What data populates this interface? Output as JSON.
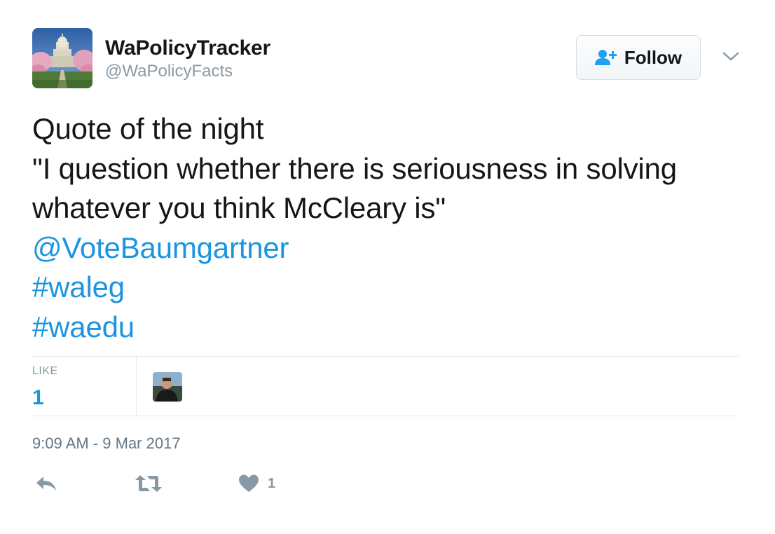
{
  "user": {
    "name": "WaPolicyTracker",
    "handle": "@WaPolicyFacts",
    "avatar_icon": "capitol-building-photo"
  },
  "follow_button": {
    "label": "Follow",
    "icon": "add-person-icon"
  },
  "menu_icon": "chevron-down-icon",
  "tweet": {
    "lines": [
      "Quote of the night",
      "\"I question whether there is seriousness in solving",
      "whatever you think McCleary is\""
    ],
    "mention": "@VoteBaumgartner",
    "hashtags": [
      "#waleg",
      "#waedu"
    ]
  },
  "stats": {
    "like_label": "LIKE",
    "like_count": "1"
  },
  "timestamp": "9:09 AM - 9 Mar 2017",
  "actions": {
    "reply_icon": "reply-icon",
    "retweet_icon": "retweet-icon",
    "like_icon": "heart-icon",
    "like_count": "1"
  },
  "colors": {
    "link": "#1b95e0",
    "muted": "#8899a6",
    "text": "#14171a",
    "divider": "#e1e8ed"
  }
}
